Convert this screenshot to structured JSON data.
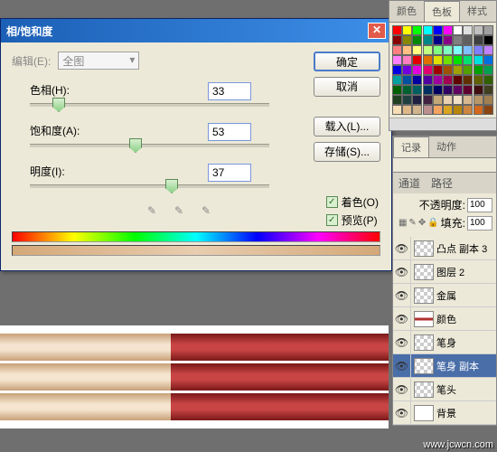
{
  "dialog": {
    "title": "相/饱和度",
    "edit_label": "编辑(E):",
    "edit_value": "全图",
    "hue_label": "色相(H):",
    "hue_value": "33",
    "sat_label": "饱和度(A):",
    "sat_value": "53",
    "light_label": "明度(I):",
    "light_value": "37",
    "ok": "确定",
    "cancel": "取消",
    "load": "载入(L)...",
    "save": "存储(S)...",
    "colorize": "着色(O)",
    "preview": "预览(P)"
  },
  "color_panel": {
    "tab1": "颜色",
    "tab2": "色板",
    "tab3": "样式"
  },
  "history_panel": {
    "tab1": "记录",
    "tab2": "动作"
  },
  "layers_panel": {
    "tab1": "通道",
    "tab2": "路径",
    "opacity_label": "不透明度:",
    "opacity_value": "100",
    "fill_label": "填充:",
    "fill_value": "100",
    "layers": [
      {
        "name": "凸点 副本 3"
      },
      {
        "name": "图层 2"
      },
      {
        "name": "金属"
      },
      {
        "name": "颜色"
      },
      {
        "name": "笔身"
      },
      {
        "name": "笔身 副本"
      },
      {
        "name": "笔头"
      },
      {
        "name": "背景"
      }
    ]
  },
  "watermark": "www.jcwcn.com"
}
